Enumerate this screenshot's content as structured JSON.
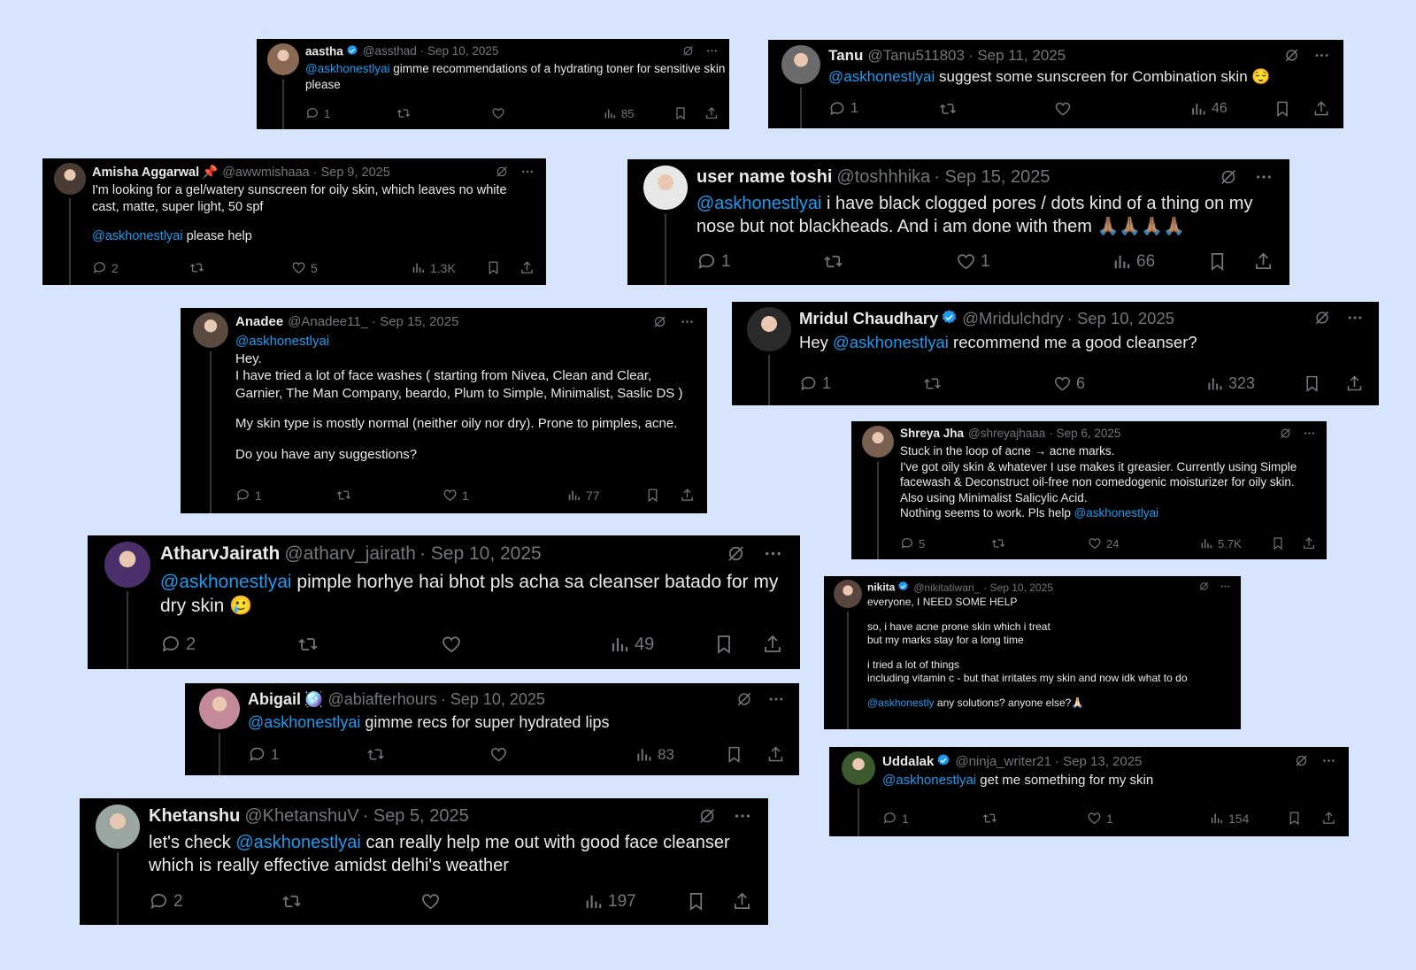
{
  "colors": {
    "background": "#d6e5fb",
    "card": "#000000",
    "text": "#e7e9ea",
    "muted": "#71767b",
    "mention": "#1d9bf0",
    "verified": "#1d9bf0"
  },
  "tweets": [
    {
      "name": "aastha",
      "handle": "@assthad",
      "date": "· Sep 10, 2025",
      "verified": true,
      "body": [
        {
          "t": "@askhonestlyai",
          "m": true
        },
        {
          "t": " gimme recommendations of a hydrating toner for sensitive skin please"
        }
      ],
      "replies": "1",
      "reposts": "",
      "likes": "",
      "views": "85"
    },
    {
      "name": "Tanu",
      "handle": "@Tanu511803",
      "date": "· Sep 11, 2025",
      "verified": false,
      "body": [
        {
          "t": "@askhonestlyai",
          "m": true
        },
        {
          "t": " suggest some sunscreen for Combination skin 😌"
        }
      ],
      "replies": "1",
      "reposts": "",
      "likes": "",
      "views": "46"
    },
    {
      "name": "Amisha Aggarwal",
      "handle": "@awwmishaaa",
      "date": "· Sep 9, 2025",
      "verified": false,
      "emoji": "📌",
      "body": [
        {
          "t": "I'm looking for a gel/watery sunscreen for oily skin, which leaves no white cast, matte, super light, 50 spf"
        },
        {
          "br": true,
          "gap": true
        },
        {
          "t": "@askhonestlyai",
          "m": true
        },
        {
          "t": " please help"
        }
      ],
      "replies": "2",
      "reposts": "",
      "likes": "5",
      "views": "1.3K"
    },
    {
      "name": "user name toshi",
      "handle": "@toshhhika",
      "date": "· Sep 15, 2025",
      "verified": false,
      "body": [
        {
          "t": "@askhonestlyai",
          "m": true
        },
        {
          "t": " i have black clogged pores / dots kind of a thing on my nose but not blackheads. And i am done with them 🙏🏽🙏🏽🙏🏽🙏🏽"
        }
      ],
      "replies": "1",
      "reposts": "",
      "likes": "1",
      "views": "66"
    },
    {
      "name": "Anadee",
      "handle": "@Anadee11_",
      "date": "· Sep 15, 2025",
      "verified": false,
      "body": [
        {
          "t": "@askhonestlyai",
          "m": true
        },
        {
          "br": true
        },
        {
          "t": "Hey."
        },
        {
          "br": true
        },
        {
          "t": "I have tried a lot of face washes ( starting from Nivea, Clean and Clear, Garnier, The Man Company, beardo, Plum to Simple, Minimalist, Saslic DS )"
        },
        {
          "br": true,
          "gap": true
        },
        {
          "t": "My skin type is mostly normal (neither oily nor dry). Prone to pimples, acne."
        },
        {
          "br": true,
          "gap": true
        },
        {
          "t": "Do you have any suggestions?"
        }
      ],
      "replies": "1",
      "reposts": "",
      "likes": "1",
      "views": "77"
    },
    {
      "name": "Mridul Chaudhary",
      "handle": "@Mridulchdry",
      "date": "· Sep 10, 2025",
      "verified": true,
      "body": [
        {
          "t": "Hey "
        },
        {
          "t": "@askhonestlyai",
          "m": true
        },
        {
          "t": " recommend me a good cleanser?"
        }
      ],
      "replies": "1",
      "reposts": "",
      "likes": "6",
      "views": "323"
    },
    {
      "name": "Shreya Jha",
      "handle": "@shreyajhaaa",
      "date": "· Sep 6, 2025",
      "verified": false,
      "body": [
        {
          "t": "Stuck in the loop of acne → acne marks."
        },
        {
          "br": true
        },
        {
          "t": "I've got oily skin & whatever I use makes it greasier. Currently using Simple facewash & Deconstruct oil-free non comedogenic moisturizer for oily skin."
        },
        {
          "br": true
        },
        {
          "t": "Also using Minimalist Salicylic Acid."
        },
        {
          "br": true
        },
        {
          "t": "Nothing seems to work. Pls help "
        },
        {
          "t": "@askhonestlyai",
          "m": true
        }
      ],
      "replies": "5",
      "reposts": "",
      "likes": "24",
      "views": "5.7K"
    },
    {
      "name": "AtharvJairath",
      "handle": "@atharv_jairath",
      "date": "· Sep 10, 2025",
      "verified": false,
      "body": [
        {
          "t": "@askhonestlyai",
          "m": true
        },
        {
          "t": " pimple horhye hai bhot pls acha sa cleanser batado for my dry skin 🥲"
        }
      ],
      "replies": "2",
      "reposts": "",
      "likes": "",
      "views": "49"
    },
    {
      "name": "nikita",
      "handle": "@nikitatiwari_",
      "date": "· Sep 10, 2025",
      "verified": true,
      "body": [
        {
          "t": "everyone, I NEED SOME HELP"
        },
        {
          "br": true,
          "gap": true
        },
        {
          "t": "so, i have acne prone skin which i treat"
        },
        {
          "br": true
        },
        {
          "t": "but my marks stay for a long time"
        },
        {
          "br": true,
          "gap": true
        },
        {
          "t": "i tried a lot of things"
        },
        {
          "br": true
        },
        {
          "t": "including vitamin c - but that irritates my skin and now idk what to do"
        },
        {
          "br": true,
          "gap": true
        },
        {
          "t": "@askhonestly",
          "m": true
        },
        {
          "t": " any solutions? anyone else?🙏🏻"
        }
      ],
      "replies": "",
      "reposts": "",
      "likes": "",
      "views": ""
    },
    {
      "name": "Abigail",
      "handle": "@abiafterhours",
      "date": "· Sep 10, 2025",
      "verified": false,
      "emoji": "🪩",
      "body": [
        {
          "t": "@askhonestlyai",
          "m": true
        },
        {
          "t": " gimme recs for super hydrated lips"
        }
      ],
      "replies": "1",
      "reposts": "",
      "likes": "",
      "views": "83"
    },
    {
      "name": "Uddalak",
      "handle": "@ninja_writer21",
      "date": "· Sep 13, 2025",
      "verified": true,
      "body": [
        {
          "t": "@askhonestlyai",
          "m": true
        },
        {
          "t": " get me something for my skin"
        }
      ],
      "replies": "1",
      "reposts": "",
      "likes": "1",
      "views": "154"
    },
    {
      "name": "Khetanshu",
      "handle": "@KhetanshuV",
      "date": "· Sep 5, 2025",
      "verified": false,
      "body": [
        {
          "t": "let's check "
        },
        {
          "t": "@askhonestlyai",
          "m": true
        },
        {
          "t": " can really help me out with good face cleanser which is really effective amidst delhi's weather"
        }
      ],
      "replies": "2",
      "reposts": "",
      "likes": "",
      "views": "197"
    }
  ]
}
